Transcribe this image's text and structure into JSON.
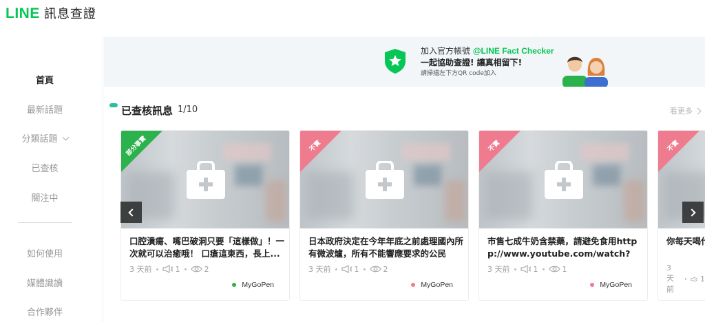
{
  "header": {
    "logo_brand": "LINE",
    "logo_title": "訊息查證"
  },
  "sidebar": {
    "items": [
      {
        "label": "首頁",
        "active": true
      },
      {
        "label": "最新話題"
      },
      {
        "label": "分類話題"
      },
      {
        "label": "已查核"
      },
      {
        "label": "關注中"
      },
      {
        "label": "如何使用"
      },
      {
        "label": "媒體識讀"
      },
      {
        "label": "合作夥伴"
      }
    ]
  },
  "banner": {
    "line1_prefix": "加入官方帳號 ",
    "line1_account": "@LINE Fact Checker",
    "line2": "一起協助查證! 讓真相留下!",
    "line3": "請掃描左下方QR code加入"
  },
  "section": {
    "title": "已查核訊息",
    "count": "1/10",
    "see_more": "看更多"
  },
  "cards": [
    {
      "badge": "部分事實",
      "title": "口腔潰瘍、嘴巴破洞只要「這樣做」！一次就可以治癒哦！ 口瘡這東西，長上...",
      "time": "3 天前",
      "reports": "1",
      "views": "2",
      "source": "MyGoPen"
    },
    {
      "badge": "不實",
      "title": "日本政府決定在今年年底之前處理國內所有微波爐，所有不能響應要求的公民和...",
      "time": "3 天前",
      "reports": "1",
      "views": "2",
      "source": "MyGoPen"
    },
    {
      "badge": "不實",
      "title": "市售七成牛奶含禁藥，請避免食用http p://www.youtube.com/watch?v...",
      "time": "3 天前",
      "reports": "1",
      "views": "1",
      "source": "MyGoPen"
    },
    {
      "badge": "不實",
      "title": "你每天喝什麼飲料？ 素、雌激素...",
      "time": "3 天前",
      "reports": "1",
      "views": "",
      "source": ""
    }
  ],
  "colors": {
    "brand": "#06c755",
    "badge_partial": "#2bb24c",
    "badge_false": "#ef7c8e",
    "source_dot_1": "#28b44a",
    "source_dot_2": "#ef7c8e"
  }
}
